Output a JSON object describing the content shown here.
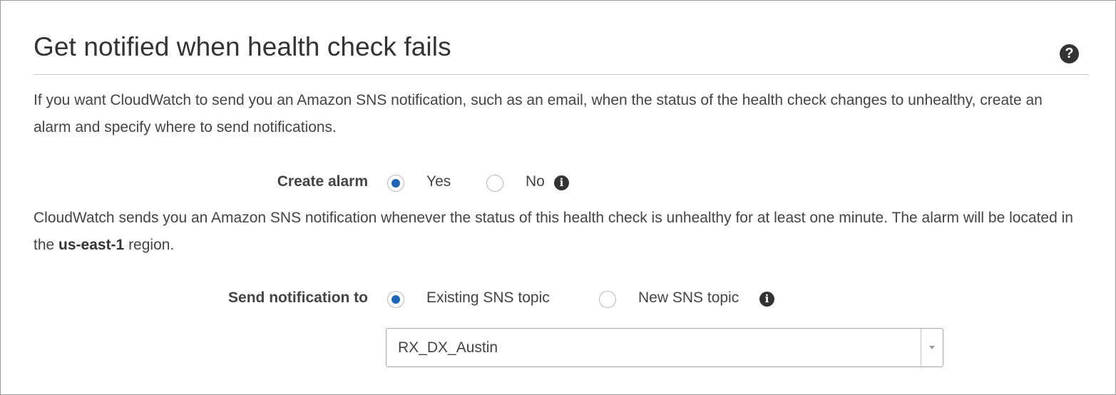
{
  "panel": {
    "title": "Get notified when health check fails",
    "help_icon": "question-circle-icon",
    "help_glyph": "?",
    "description": "If you want CloudWatch to send you an Amazon SNS notification, such as an email, when the status of the health check changes to unhealthy, create an alarm and specify where to send notifications."
  },
  "create_alarm": {
    "label": "Create alarm",
    "options": [
      {
        "label": "Yes",
        "checked": true
      },
      {
        "label": "No",
        "checked": false
      }
    ],
    "info_icon": "info-icon",
    "info_glyph": "i"
  },
  "alarm_note": {
    "before": "CloudWatch sends you an Amazon SNS notification whenever the status of this health check is unhealthy for at least one minute. The alarm will be located in the ",
    "region": "us-east-1",
    "after": " region."
  },
  "send_notification": {
    "label": "Send notification to",
    "options": [
      {
        "label": "Existing SNS topic",
        "checked": true
      },
      {
        "label": "New SNS topic",
        "checked": false
      }
    ],
    "info_icon": "info-icon",
    "info_glyph": "i"
  },
  "topic_select": {
    "value": "RX_DX_Austin",
    "dropdown_icon": "chevron-down-icon"
  },
  "colors": {
    "radio_selected": "#2066b8",
    "text": "#444444",
    "border": "#9a9a9a"
  }
}
